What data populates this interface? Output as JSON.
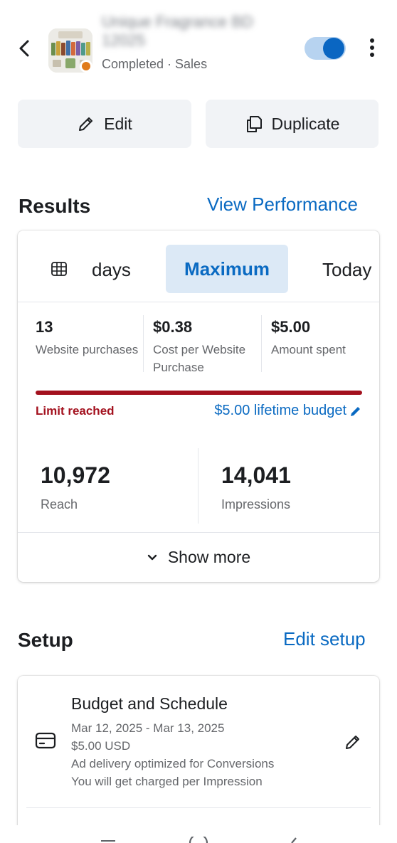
{
  "header": {
    "title_line1": "Unique Fragrance BD",
    "title_line2": "12025",
    "subtitle": "Completed · Sales",
    "status_color": "#e07b1a",
    "toggle_on": true
  },
  "actions": {
    "edit_label": "Edit",
    "duplicate_label": "Duplicate"
  },
  "results": {
    "title": "Results",
    "link": "View Performance",
    "tabs": [
      "days",
      "Maximum",
      "Today"
    ],
    "selected_tab": "Maximum",
    "metrics": [
      {
        "value": "13",
        "label": "Website purchases"
      },
      {
        "value": "$0.38",
        "label": "Cost per Website Purchase"
      },
      {
        "value": "$5.00",
        "label": "Amount spent"
      }
    ],
    "budget_progress": 1.0,
    "limit_text": "Limit reached",
    "budget_text": "$5.00 lifetime budget",
    "big_metrics": [
      {
        "value": "10,972",
        "label": "Reach"
      },
      {
        "value": "14,041",
        "label": "Impressions"
      }
    ],
    "show_more": "Show more"
  },
  "setup": {
    "title": "Setup",
    "link": "Edit setup",
    "item_title": "Budget and Schedule",
    "lines": [
      "Mar 12, 2025 - Mar 13, 2025",
      "$5.00 USD",
      "Ad delivery optimized for Conversions",
      "You will get charged per Impression"
    ]
  },
  "colors": {
    "accent": "#0a6ac2",
    "limit_red": "#a3111e",
    "tab_selected_bg": "#dce9f6"
  }
}
